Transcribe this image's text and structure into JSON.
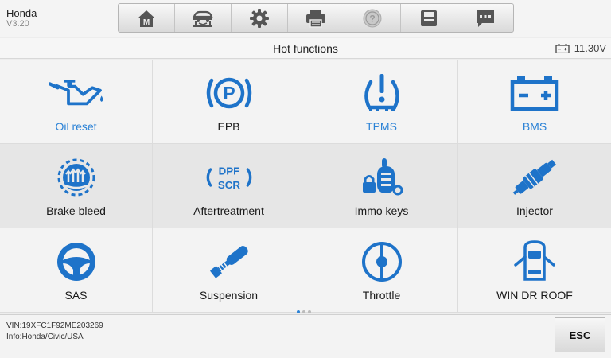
{
  "app": {
    "make": "Honda",
    "version": "V3.20"
  },
  "toolbar": {
    "buttons": [
      {
        "icon": "home-icon"
      },
      {
        "icon": "vehicle-lift-icon"
      },
      {
        "icon": "settings-gear-icon"
      },
      {
        "icon": "printer-icon"
      },
      {
        "icon": "help-icon"
      },
      {
        "icon": "save-icon"
      },
      {
        "icon": "message-icon"
      }
    ]
  },
  "header": {
    "title": "Hot functions",
    "battery_voltage": "11.30V"
  },
  "functions": [
    {
      "label": "Oil reset",
      "icon": "oil-can-icon",
      "highlight": true
    },
    {
      "label": "EPB",
      "icon": "parking-brake-icon",
      "highlight": false
    },
    {
      "label": "TPMS",
      "icon": "tire-pressure-icon",
      "highlight": true
    },
    {
      "label": "BMS",
      "icon": "battery-icon",
      "highlight": true
    },
    {
      "label": "Brake bleed",
      "icon": "brake-bleed-icon",
      "highlight": false
    },
    {
      "label": "Aftertreatment",
      "icon": "dpf-scr-icon",
      "icon_text": [
        "DPF",
        "SCR"
      ],
      "highlight": false
    },
    {
      "label": "Immo keys",
      "icon": "immo-keys-icon",
      "highlight": false
    },
    {
      "label": "Injector",
      "icon": "injector-icon",
      "highlight": false
    },
    {
      "label": "SAS",
      "icon": "steering-wheel-icon",
      "highlight": false
    },
    {
      "label": "Suspension",
      "icon": "suspension-icon",
      "highlight": false
    },
    {
      "label": "Throttle",
      "icon": "throttle-icon",
      "highlight": false
    },
    {
      "label": "WIN DR ROOF",
      "icon": "car-doors-icon",
      "highlight": false
    }
  ],
  "pagination": {
    "pages": 3,
    "current": 1
  },
  "footer": {
    "vin": "VIN:19XFC1F92ME203269",
    "info": "Info:Honda/Civic/USA",
    "esc_label": "ESC"
  },
  "colors": {
    "accent": "#2b82d6",
    "icon_dark": "#1565b8"
  }
}
